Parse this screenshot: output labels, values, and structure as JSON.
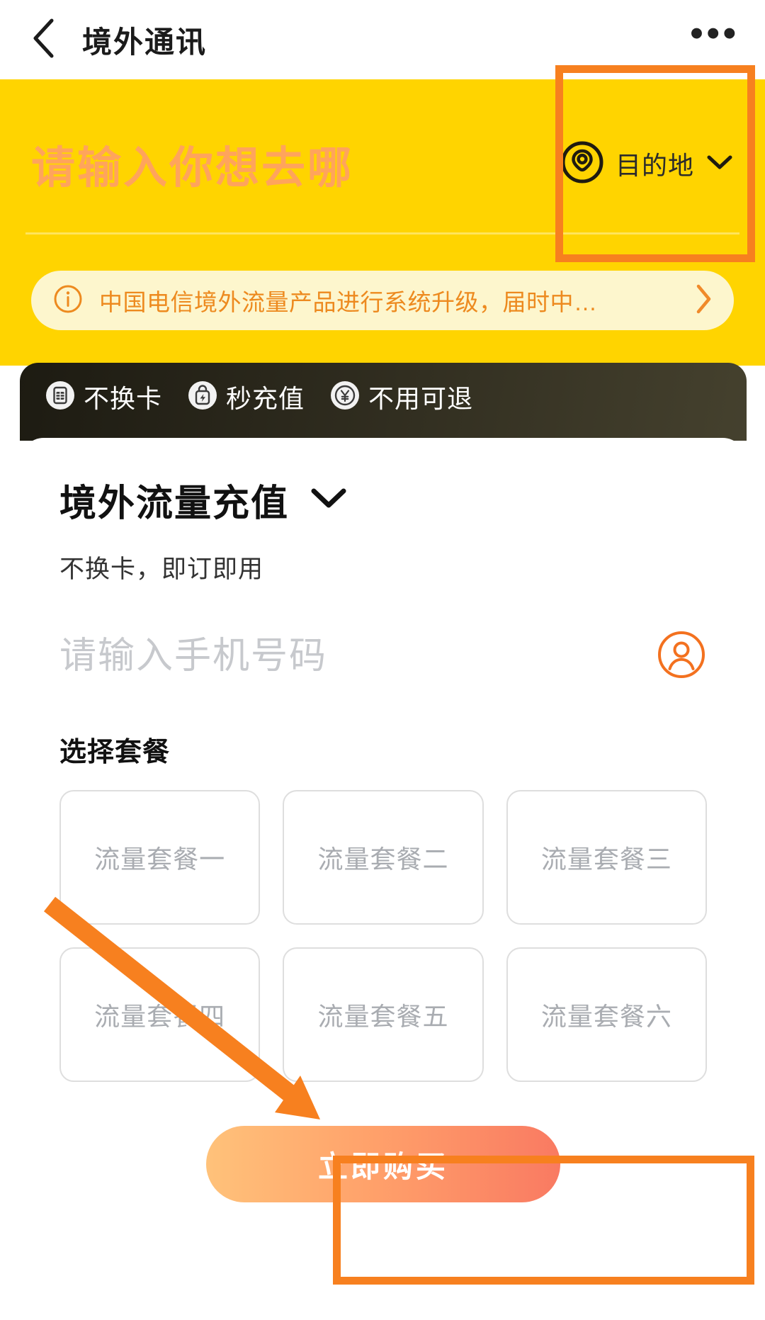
{
  "navbar": {
    "back_icon": "chevron-left-icon",
    "title": "境外通讯",
    "more_icon": "more-horizontal-icon",
    "more_label": "•••"
  },
  "hero": {
    "search_placeholder": "请输入你想去哪",
    "destination": {
      "icon": "location-pin-circle-icon",
      "label": "目的地",
      "chevron": "chevron-down-icon"
    },
    "background_color": "#ffd400",
    "placeholder_color": "#ffa45c"
  },
  "notice": {
    "icon": "info-circle-icon",
    "text": "中国电信境外流量产品进行系统升级，届时中…",
    "arrow": "chevron-right-icon",
    "background_color": "#fdf6cd",
    "text_color": "#ed8a1f"
  },
  "features": [
    {
      "icon": "sim-card-icon",
      "label": "不换卡"
    },
    {
      "icon": "instant-charge-icon",
      "label": "秒充值"
    },
    {
      "icon": "refund-yuan-icon",
      "label": "不用可退"
    }
  ],
  "card": {
    "title": "境外流量充值",
    "title_chevron": "chevron-down-icon",
    "subtitle": "不换卡，即订即用",
    "phone_field": {
      "placeholder": "请输入手机号码",
      "value": "",
      "contact_icon": "contact-person-icon"
    },
    "packages_label": "选择套餐",
    "packages": [
      {
        "label": "流量套餐一"
      },
      {
        "label": "流量套餐二"
      },
      {
        "label": "流量套餐三"
      },
      {
        "label": "流量套餐四"
      },
      {
        "label": "流量套餐五"
      },
      {
        "label": "流量套餐六"
      }
    ],
    "buy_button": "立即购买"
  },
  "annotations": {
    "highlight_color": "#f7801f",
    "boxes": [
      "destination-selector",
      "buy-button"
    ],
    "arrow": "points-from-package-one-to-package-five"
  }
}
